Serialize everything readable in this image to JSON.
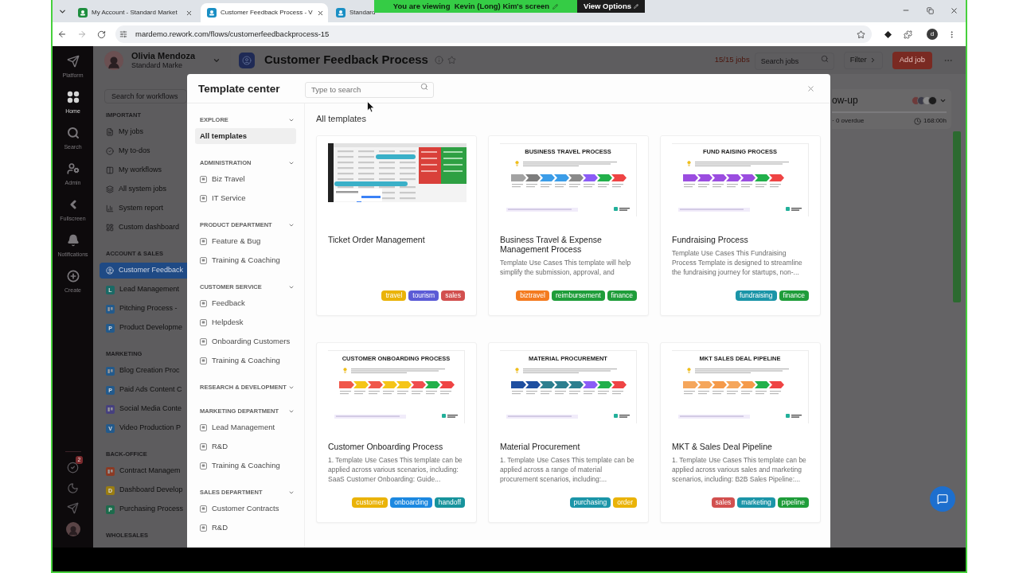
{
  "browser": {
    "tabs": [
      {
        "title": "My Account - Standard Market",
        "selected": false,
        "color": "#1e8e3e"
      },
      {
        "title": "Customer Feedback Process - V",
        "selected": true,
        "color": "#1b8fc4"
      },
      {
        "title": "Standard",
        "selected": false,
        "color": "#1b8fc4"
      }
    ],
    "url": "mardemo.rework.com/flows/customerfeedbackprocess-15",
    "profile": "d"
  },
  "share_banner": {
    "message": "You are viewing  Kevin (Long) Kim's screen",
    "button": "View Options"
  },
  "rail": {
    "items": [
      {
        "label": "Platform",
        "kind": "platform",
        "selected": false
      },
      {
        "label": "Home",
        "kind": "home",
        "selected": true
      },
      {
        "label": "Search",
        "kind": "search",
        "selected": false
      },
      {
        "label": "Admin",
        "kind": "admin",
        "selected": false
      },
      {
        "label": "Fullscreen",
        "kind": "fullscreen",
        "selected": false
      },
      {
        "label": "Notifications",
        "kind": "notifications",
        "selected": false
      },
      {
        "label": "Create",
        "kind": "create",
        "selected": false
      }
    ],
    "todo_badge": "2"
  },
  "sidebar": {
    "user": {
      "name": "Olivia Mendoza",
      "subtitle": "Standard Marke"
    },
    "search_placeholder": "Search for workflows",
    "sections": [
      {
        "heading": "IMPORTANT",
        "items": [
          {
            "label": "My jobs",
            "kind": "jobs",
            "selected": false
          },
          {
            "label": "My to-dos",
            "kind": "todos",
            "selected": false
          },
          {
            "label": "My workflows",
            "kind": "workflows",
            "selected": false
          },
          {
            "label": "All system jobs",
            "kind": "layers",
            "selected": false
          },
          {
            "label": "System report",
            "kind": "report",
            "selected": false
          },
          {
            "label": "Custom dashboard",
            "kind": "dashboard",
            "selected": false
          }
        ]
      },
      {
        "heading": "ACCOUNT & SALES",
        "items": [
          {
            "label": "Customer Feedback",
            "kind": "feedback",
            "selected": true
          },
          {
            "label": "Lead Management",
            "kind": "letter",
            "letter": "L",
            "color": "#1a6a66",
            "selected": false
          },
          {
            "label": "Pitching Process -",
            "kind": "board",
            "color": "#235a8c",
            "selected": false
          },
          {
            "label": "Product Developme",
            "kind": "letter",
            "letter": "P",
            "color": "#235a8c",
            "selected": false
          }
        ]
      },
      {
        "heading": "MARKETING",
        "items": [
          {
            "label": "Blog Creation Proc",
            "kind": "board",
            "color": "#235a8c",
            "selected": false
          },
          {
            "label": "Paid Ads Content C",
            "kind": "letter",
            "letter": "P",
            "color": "#235a8c",
            "selected": false
          },
          {
            "label": "Social Media Conte",
            "kind": "board",
            "color": "#46407f",
            "selected": false
          },
          {
            "label": "Video Production P",
            "kind": "letter",
            "letter": "V",
            "color": "#235a8c",
            "selected": false
          }
        ]
      },
      {
        "heading": "BACK-OFFICE",
        "items": [
          {
            "label": "Contract Managem",
            "kind": "board",
            "color": "#8c3a24",
            "selected": false
          },
          {
            "label": "Dashboard Develop",
            "kind": "letter",
            "letter": "D",
            "color": "#9a7d12",
            "selected": false
          },
          {
            "label": "Purchasing Process",
            "kind": "letter",
            "letter": "P",
            "color": "#1d6b4c",
            "selected": false
          }
        ]
      },
      {
        "heading": "WHOLESALES"
      }
    ]
  },
  "main": {
    "title": "Customer Feedback Process",
    "job_count": "15/15 jobs",
    "search_placeholder": "Search jobs",
    "filter": "Filter",
    "add_job": "Add job",
    "column": {
      "title": "ow-up",
      "summary": "· 0 overdue",
      "duration": "168:00h"
    }
  },
  "modal": {
    "title": "Template center",
    "search_placeholder": "Type to search",
    "nav": [
      {
        "heading": "EXPLORE",
        "expanded": true,
        "items": [
          {
            "label": "All templates",
            "kind": "all",
            "selected": true
          }
        ]
      },
      {
        "heading": "ADMINISTRATION",
        "expanded": true,
        "items": [
          {
            "label": "Biz Travel",
            "kind": "template",
            "selected": false
          },
          {
            "label": "IT Service",
            "kind": "template",
            "selected": false
          }
        ]
      },
      {
        "heading": "PRODUCT DEPARTMENT",
        "expanded": true,
        "items": [
          {
            "label": "Feature & Bug",
            "kind": "template",
            "selected": false
          },
          {
            "label": "Training & Coaching",
            "kind": "template",
            "selected": false
          }
        ]
      },
      {
        "heading": "CUSTOMER SERVICE",
        "expanded": true,
        "items": [
          {
            "label": "Feedback",
            "kind": "template",
            "selected": false
          },
          {
            "label": "Helpdesk",
            "kind": "template",
            "selected": false
          },
          {
            "label": "Onboarding Customers",
            "kind": "template",
            "selected": false
          },
          {
            "label": "Training & Coaching",
            "kind": "template",
            "selected": false
          }
        ]
      },
      {
        "heading": "RESEARCH & DEVELOPMENT",
        "expanded": true
      },
      {
        "heading": "MARKETING DEPARTMENT",
        "expanded": true,
        "items": [
          {
            "label": "Lead Management",
            "kind": "template",
            "selected": false
          },
          {
            "label": "R&D",
            "kind": "template",
            "selected": false
          },
          {
            "label": "Training & Coaching",
            "kind": "template",
            "selected": false
          }
        ]
      },
      {
        "heading": "SALES DEPARTMENT",
        "expanded": true,
        "items": [
          {
            "label": "Customer Contracts",
            "kind": "template",
            "selected": false
          },
          {
            "label": "R&D",
            "kind": "template",
            "selected": false
          }
        ]
      }
    ],
    "heading": "All templates",
    "templates": [
      {
        "title": "Ticket Order Management",
        "thumbnail": {
          "kind": "screenshot"
        },
        "tags": [
          {
            "label": "travel",
            "color": "#eab308"
          },
          {
            "label": "tourism",
            "color": "#5b5bd6"
          },
          {
            "label": "sales",
            "color": "#d2504f"
          }
        ]
      },
      {
        "title": "Business Travel & Expense Management Process",
        "description": "Template Use Cases This template will help simplify the submission, approval, and",
        "thumbnail": {
          "kind": "process",
          "title": "BUSINESS TRAVEL PROCESS",
          "steps": [
            {
              "color": "#a3a3a3"
            },
            {
              "color": "#7d7d7d"
            },
            {
              "color": "#3b9de8"
            },
            {
              "color": "#3b9de8"
            },
            {
              "color": "#8a8a8a"
            },
            {
              "color": "#8b5cf6"
            },
            {
              "color": "#22b04b"
            },
            {
              "color": "#ef4444"
            }
          ]
        },
        "tags": [
          {
            "label": "biztravel",
            "color": "#f47b20"
          },
          {
            "label": "reimbursement",
            "color": "#1f9d3a"
          },
          {
            "label": "finance",
            "color": "#1f9d3a"
          }
        ]
      },
      {
        "title": "Fundraising Process",
        "description": "Template Use Cases This Fundraising Process Template is designed to streamline the fundraising journey for startups, non-...",
        "thumbnail": {
          "kind": "process",
          "title": "FUND RAISING PROCESS",
          "steps": [
            {
              "color": "#9b4de0"
            },
            {
              "color": "#9b4de0"
            },
            {
              "color": "#9b4de0"
            },
            {
              "color": "#9b4de0"
            },
            {
              "color": "#9b4de0"
            },
            {
              "color": "#22b04b"
            },
            {
              "color": "#ef4444"
            }
          ]
        },
        "tags": [
          {
            "label": "fundraising",
            "color": "#1b95a8"
          },
          {
            "label": "finance",
            "color": "#1f9d3a"
          }
        ]
      },
      {
        "title": "Customer Onboarding Process",
        "description": "1. Template Use Cases This template can be applied across various scenarios, including: SaaS Customer Onboarding: Guide...",
        "thumbnail": {
          "kind": "process",
          "title": "CUSTOMER ONBOARDING PROCESS",
          "steps": [
            {
              "color": "#f0574a"
            },
            {
              "color": "#f5c518"
            },
            {
              "color": "#f0574a"
            },
            {
              "color": "#f5c518"
            },
            {
              "color": "#f5c518"
            },
            {
              "color": "#ef4d4d"
            },
            {
              "color": "#22b04b"
            },
            {
              "color": "#ef4444"
            }
          ]
        },
        "tags": [
          {
            "label": "customer",
            "color": "#eab308"
          },
          {
            "label": "onboarding",
            "color": "#1c88e0"
          },
          {
            "label": "handoff",
            "color": "#17939c"
          }
        ]
      },
      {
        "title": "Material Procurement",
        "description": "1. Template Use Cases This template can be applied across a range of material procurement scenarios, including:...",
        "thumbnail": {
          "kind": "process",
          "title": "MATERIAL PROCUREMENT",
          "steps": [
            {
              "color": "#1f4fa0"
            },
            {
              "color": "#1f4fa0"
            },
            {
              "color": "#2c7f8f"
            },
            {
              "color": "#2c7f8f"
            },
            {
              "color": "#2c7f8f"
            },
            {
              "color": "#8b5cf6"
            },
            {
              "color": "#22b04b"
            },
            {
              "color": "#ef4444"
            }
          ]
        },
        "tags": [
          {
            "label": "purchasing",
            "color": "#1b95a8"
          },
          {
            "label": "order",
            "color": "#eab308"
          }
        ]
      },
      {
        "title": "MKT & Sales Deal Pipeline",
        "description": "1. Template Use Cases This template can be applied across various sales and marketing scenarios, including: B2B Sales Pipeline:...",
        "thumbnail": {
          "kind": "process",
          "title": "MKT SALES DEAL PIPELINE",
          "steps": [
            {
              "color": "#f5a65b"
            },
            {
              "color": "#f5a65b"
            },
            {
              "color": "#f59a4a"
            },
            {
              "color": "#f5a65b"
            },
            {
              "color": "#f59a4a"
            },
            {
              "color": "#22b04b"
            },
            {
              "color": "#ef4444"
            }
          ]
        },
        "tags": [
          {
            "label": "sales",
            "color": "#d2504f"
          },
          {
            "label": "marketing",
            "color": "#1b95a8"
          },
          {
            "label": "pipeline",
            "color": "#1f9d3a"
          }
        ]
      }
    ]
  }
}
